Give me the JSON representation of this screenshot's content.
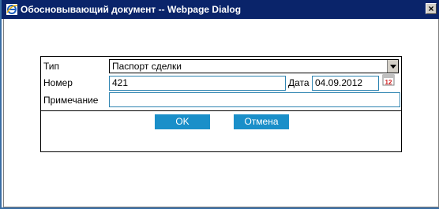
{
  "window": {
    "title": "Обосновывающий документ -- Webpage Dialog",
    "close_label": "×"
  },
  "form": {
    "type_label": "Тип",
    "type_value": "Паспорт сделки",
    "number_label": "Номер",
    "number_value": "421",
    "date_label": "Дата",
    "date_value": "04.09.2012",
    "note_label": "Примечание",
    "note_value": ""
  },
  "buttons": {
    "ok_label": "OK",
    "cancel_label": "Отмена"
  },
  "icons": {
    "window_icon": "internet-explorer-icon",
    "calendar_icon": "calendar-icon",
    "calendar_badge": "12"
  },
  "colors": {
    "titlebar": "#0a246a",
    "button": "#1a8fc9",
    "field_border": "#2d83b0"
  }
}
